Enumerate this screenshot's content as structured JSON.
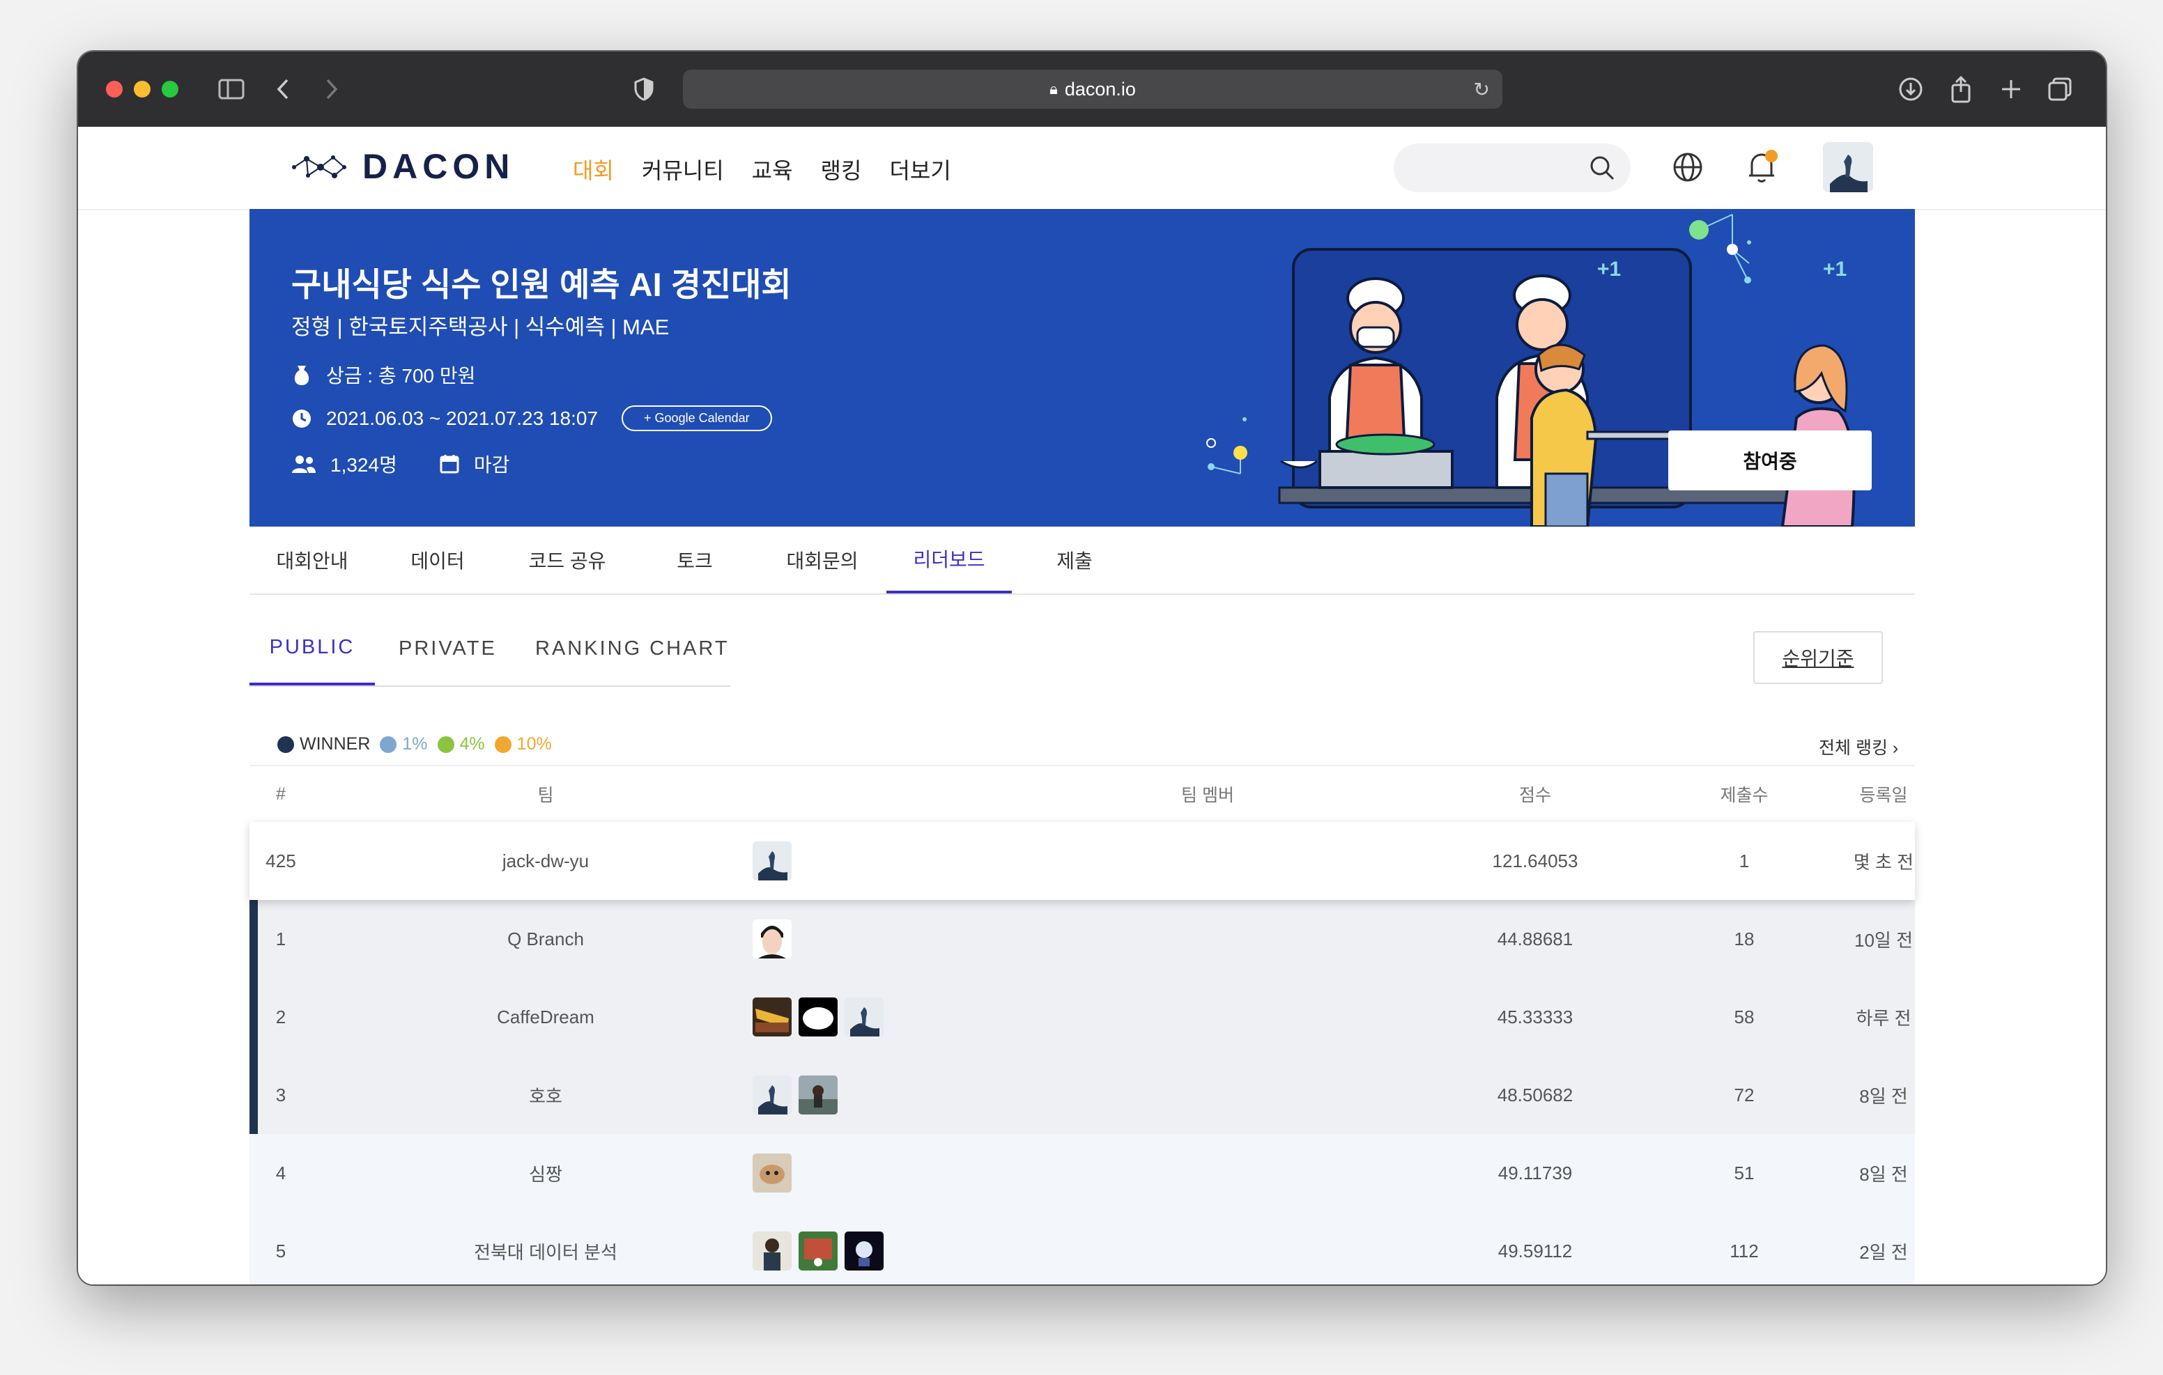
{
  "browser": {
    "url": "dacon.io"
  },
  "site": {
    "logo_text": "DACON",
    "menu": [
      "대회",
      "커뮤니티",
      "교육",
      "랭킹",
      "더보기"
    ]
  },
  "competition": {
    "title": "구내식당 식수 인원 예측 AI 경진대회",
    "subtitle": "정형 | 한국토지주택공사 | 식수예측 | MAE",
    "prize": "상금 : 총 700 만원",
    "period": "2021.06.03 ~ 2021.07.23 18:07",
    "google_calendar": "+ Google Calendar",
    "participants": "1,324명",
    "status": "마감",
    "join_button": "참여중",
    "plus_one": "+1"
  },
  "tabs": [
    "대회안내",
    "데이터",
    "코드 공유",
    "토크",
    "대회문의",
    "리더보드",
    "제출"
  ],
  "active_tab": "리더보드",
  "subtabs": [
    "PUBLIC",
    "PRIVATE",
    "RANKING CHART"
  ],
  "rank_criteria_button": "순위기준",
  "legend": [
    {
      "label": "WINNER",
      "color": "#1f3352"
    },
    {
      "label": "1%",
      "color": "#7ea7cf"
    },
    {
      "label": "4%",
      "color": "#8cc43f"
    },
    {
      "label": "10%",
      "color": "#f0a830"
    }
  ],
  "full_ranking_link": "전체 랭킹 ›",
  "table": {
    "headers": [
      "#",
      "팀",
      "팀 멤버",
      "점수",
      "제출수",
      "등록일"
    ],
    "my_row": {
      "rank": "425",
      "team": "jack-dw-yu",
      "score": "121.64053",
      "submissions": "1",
      "date": "몇 초 전"
    },
    "rows": [
      {
        "rank": "1",
        "team": "Q Branch",
        "score": "44.88681",
        "submissions": "18",
        "date": "10일 전"
      },
      {
        "rank": "2",
        "team": "CaffeDream",
        "score": "45.33333",
        "submissions": "58",
        "date": "하루 전"
      },
      {
        "rank": "3",
        "team": "호호",
        "score": "48.50682",
        "submissions": "72",
        "date": "8일 전"
      },
      {
        "rank": "4",
        "team": "심짱",
        "score": "49.11739",
        "submissions": "51",
        "date": "8일 전"
      },
      {
        "rank": "5",
        "team": "전북대 데이터 분석",
        "score": "49.59112",
        "submissions": "112",
        "date": "2일 전"
      }
    ]
  }
}
